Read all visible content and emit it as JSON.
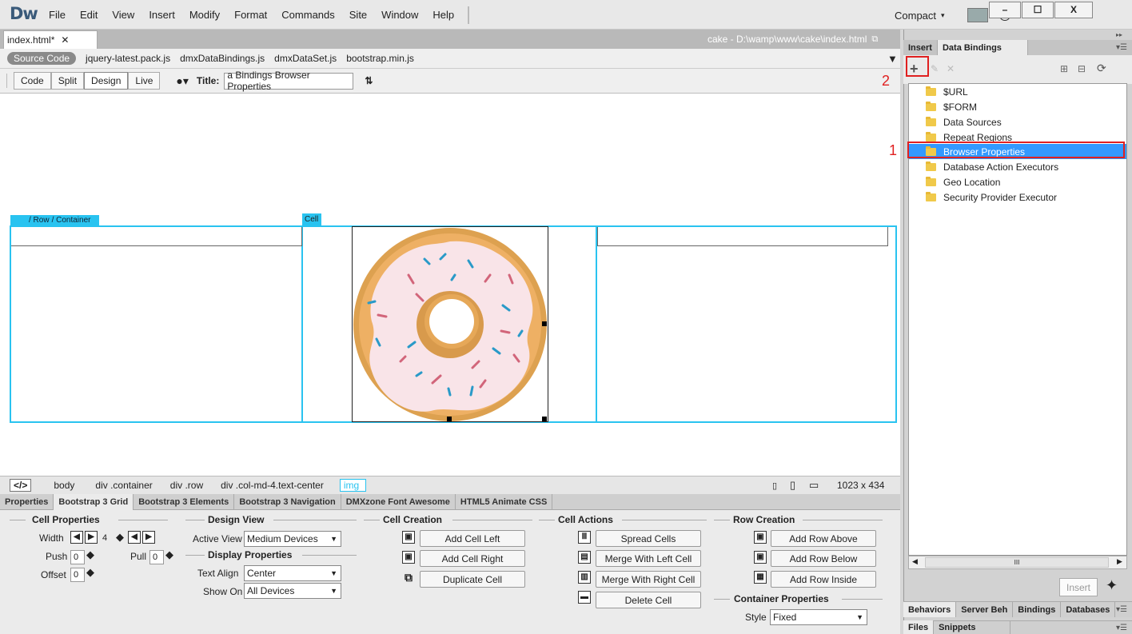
{
  "app": {
    "logo": "Dw",
    "menus": [
      "File",
      "Edit",
      "View",
      "Insert",
      "Modify",
      "Format",
      "Commands",
      "Site",
      "Window",
      "Help"
    ],
    "workspace": "Compact",
    "win_min": "–",
    "win_max": "☐",
    "win_close": "X"
  },
  "document": {
    "tab": "index.html*",
    "path": "cake - D:\\wamp\\www\\cake\\index.html",
    "related_files": [
      "Source Code",
      "jquery-latest.pack.js",
      "dmxDataBindings.js",
      "dmxDataSet.js",
      "bootstrap.min.js"
    ]
  },
  "toolbar": {
    "views": [
      "Code",
      "Split",
      "Design",
      "Live"
    ],
    "title_label": "Title:",
    "title_value": "a Bindings Browser Properties"
  },
  "canvas": {
    "row_label": "/ Row",
    "container_label": "/ Container",
    "cell_label": "Cell"
  },
  "tagbar": {
    "code_glyph": "</>",
    "tags": [
      "body",
      "div .container",
      "div .row",
      "div .col-md-4.text-center",
      "img"
    ],
    "size": "1023 x 434"
  },
  "panel_tabs": [
    "Properties",
    "Bootstrap 3 Grid",
    "Bootstrap 3 Elements",
    "Bootstrap 3 Navigation",
    "DMXzone Font Awesome",
    "HTML5 Animate CSS"
  ],
  "grid": {
    "cell_properties": {
      "title": "Cell Properties",
      "width_label": "Width",
      "width_value": "4",
      "push_label": "Push",
      "push_value": "0",
      "pull_label": "Pull",
      "pull_value": "0",
      "offset_label": "Offset",
      "offset_value": "0"
    },
    "design_view": {
      "title": "Design View",
      "active_view_label": "Active View",
      "active_view": "Medium Devices"
    },
    "display": {
      "title": "Display Properties",
      "text_align_label": "Text Align",
      "text_align": "Center",
      "show_on_label": "Show On",
      "show_on": "All Devices"
    },
    "cell_creation": {
      "title": "Cell Creation",
      "buttons": [
        "Add Cell Left",
        "Add Cell Right",
        "Duplicate Cell"
      ]
    },
    "cell_actions": {
      "title": "Cell Actions",
      "buttons": [
        "Spread Cells",
        "Merge With Left Cell",
        "Merge With Right Cell",
        "Delete Cell"
      ]
    },
    "row_creation": {
      "title": "Row Creation",
      "buttons": [
        "Add Row Above",
        "Add Row Below",
        "Add Row Inside"
      ]
    },
    "container": {
      "title": "Container Properties",
      "style_label": "Style",
      "style": "Fixed"
    }
  },
  "right_panel": {
    "tabs": [
      "Insert",
      "Data Bindings"
    ],
    "tree": [
      "$URL",
      "$FORM",
      "Data Sources",
      "Repeat Regions",
      "Browser Properties",
      "Database Action Executors",
      "Geo Location",
      "Security Provider Executor"
    ],
    "insert_button": "Insert",
    "bottom_tabs": [
      "Behaviors",
      "Server Beh",
      "Bindings",
      "Databases"
    ],
    "bottom_tabs2": [
      "Files",
      "Snippets"
    ],
    "hscroll_glyph": "III"
  },
  "annotations": {
    "one": "1",
    "two": "2"
  },
  "colors": {
    "accent_blue": "#3399ff",
    "cyan_outline": "#29c3f0",
    "annotation_red": "#e02020"
  }
}
